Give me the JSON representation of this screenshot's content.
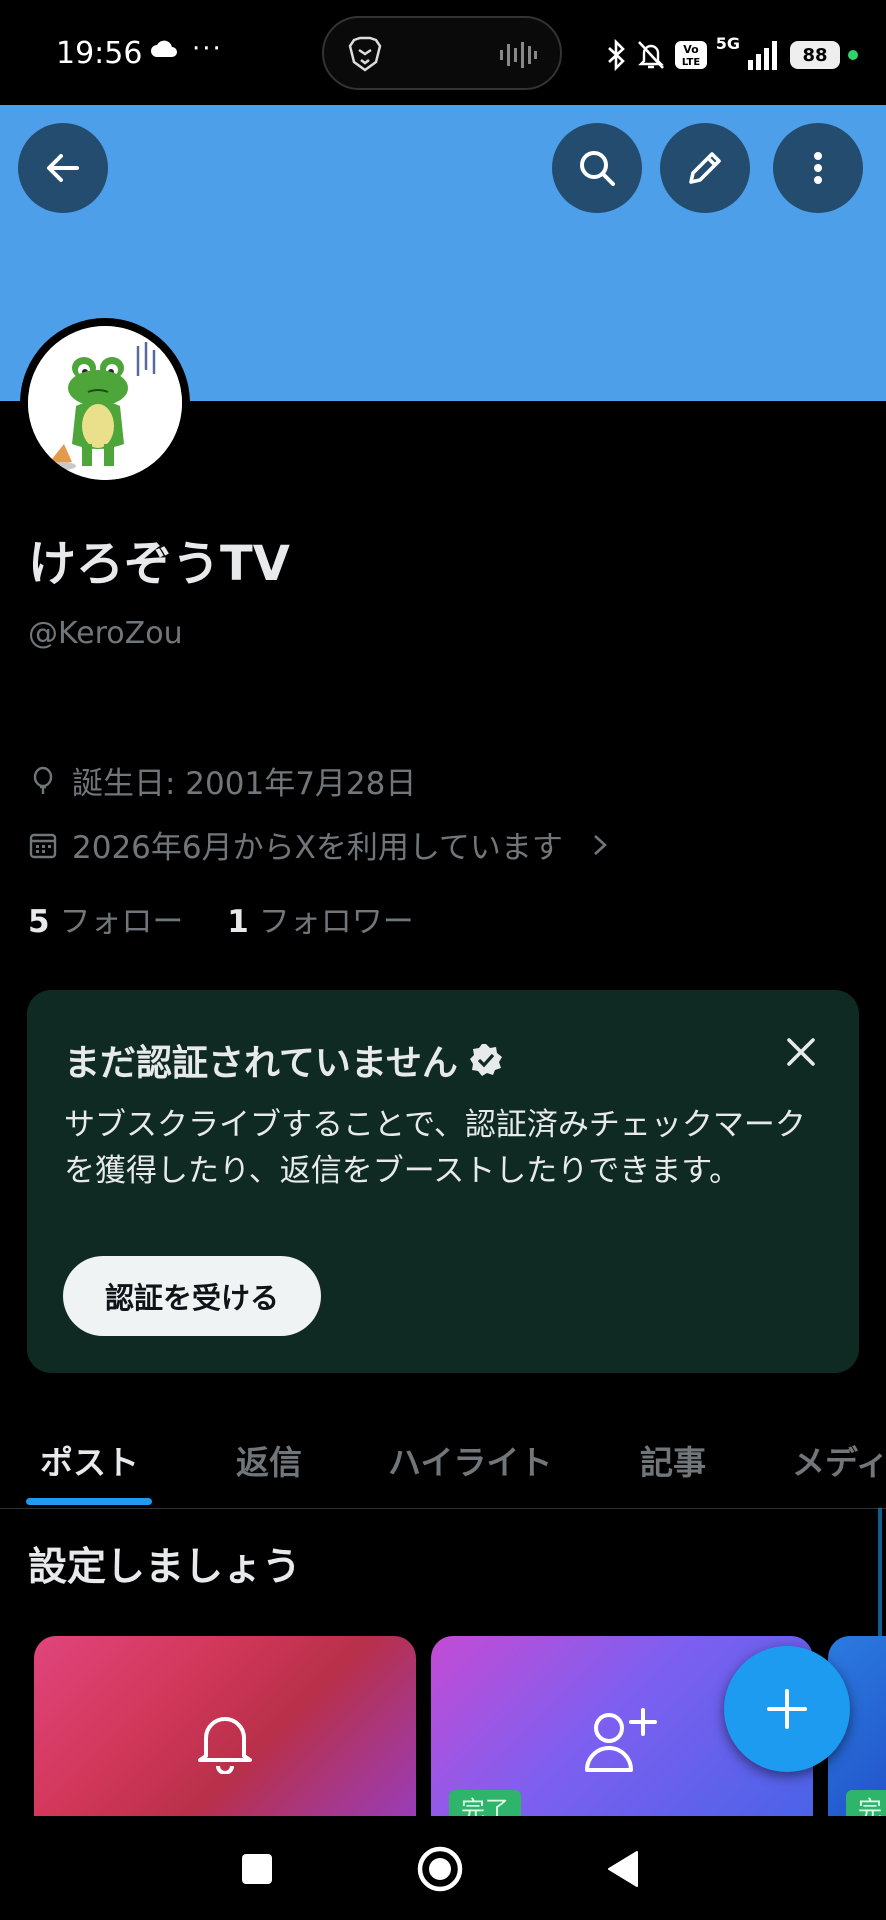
{
  "status_bar": {
    "time": "19:56",
    "more": "···",
    "volte": "Vo LTE",
    "network": "5G",
    "battery": "88",
    "icons": [
      "cloud-icon",
      "brave-lion-icon",
      "audio-bars-icon",
      "bluetooth-icon",
      "bell-muted-icon",
      "signal-icon"
    ]
  },
  "header": {
    "back_icon": "arrow-left-icon",
    "search_icon": "search-icon",
    "edit_icon": "pencil-icon",
    "more_icon": "more-vertical-icon",
    "banner_color": "#4e9fe9"
  },
  "profile": {
    "display_name": "けろぞうTV",
    "handle": "@KeroZou",
    "birthday": "誕生日: 2001年7月28日",
    "joined": "2026年6月からXを利用しています",
    "following_count": "5",
    "following_label": "フォロー",
    "followers_count": "1",
    "followers_label": "フォロワー"
  },
  "verify_card": {
    "title": "まだ認証されていません",
    "body": "サブスクライブすることで、認証済みチェックマークを獲得したり、返信をブーストしたりできます。",
    "button": "認証を受ける",
    "close_icon": "close-icon"
  },
  "tabs": [
    {
      "label": "ポスト",
      "active": true
    },
    {
      "label": "返信",
      "active": false
    },
    {
      "label": "ハイライト",
      "active": false
    },
    {
      "label": "記事",
      "active": false
    },
    {
      "label": "メディ",
      "active": false
    }
  ],
  "setup": {
    "title": "設定しましょう",
    "cards": [
      {
        "icon": "bell-icon",
        "badge": ""
      },
      {
        "icon": "add-user-icon",
        "badge": "完了"
      },
      {
        "icon": "",
        "badge": "完"
      }
    ]
  },
  "fab": {
    "icon": "plus-icon"
  },
  "nav_bar": {
    "icons": [
      "recents-square-icon",
      "home-circle-icon",
      "back-triangle-icon"
    ]
  },
  "colors": {
    "accent": "#1d9bf0",
    "card_bg": "#0f2a23",
    "banner": "#4e9fe9"
  }
}
